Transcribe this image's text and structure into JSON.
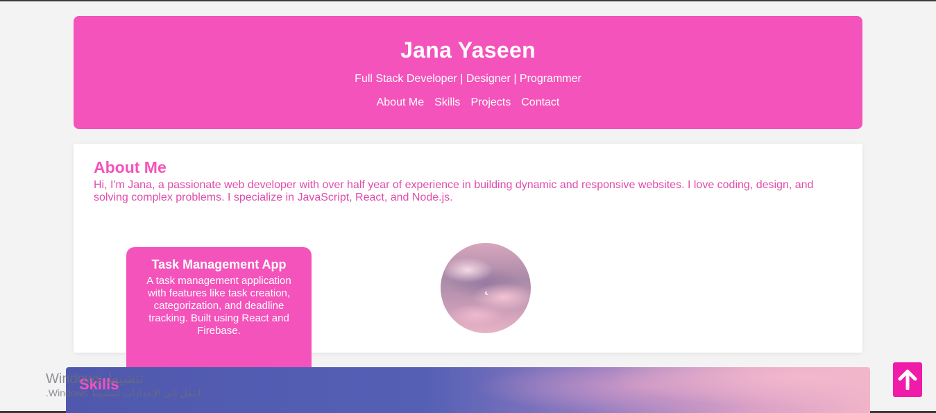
{
  "header": {
    "name": "Jana Yaseen",
    "tagline": "Full Stack Developer | Designer | Programmer",
    "nav": [
      {
        "label": "About Me"
      },
      {
        "label": "Skills"
      },
      {
        "label": "Projects"
      },
      {
        "label": "Contact"
      }
    ]
  },
  "about": {
    "title": "About Me",
    "text": "Hi, I'm Jana, a passionate web developer with over half year of experience in building dynamic and responsive websites. I love coding, design, and solving complex problems. I specialize in JavaScript, React, and Node.js."
  },
  "project_card": {
    "title": "Task Management App",
    "description": "A task management application with features like task creation, categorization, and deadline tracking. Built using React and Firebase."
  },
  "skills": {
    "title": "Skills"
  },
  "watermark": {
    "line1": "تنشيط Windows",
    "line2": "انتقل إلى الإعدادات لتنشيط Windows."
  },
  "back_to_top": {
    "icon": "arrow-up-icon"
  },
  "colors": {
    "accent": "#f453bb",
    "button": "#f01ba9",
    "background": "#f3f3f3"
  }
}
